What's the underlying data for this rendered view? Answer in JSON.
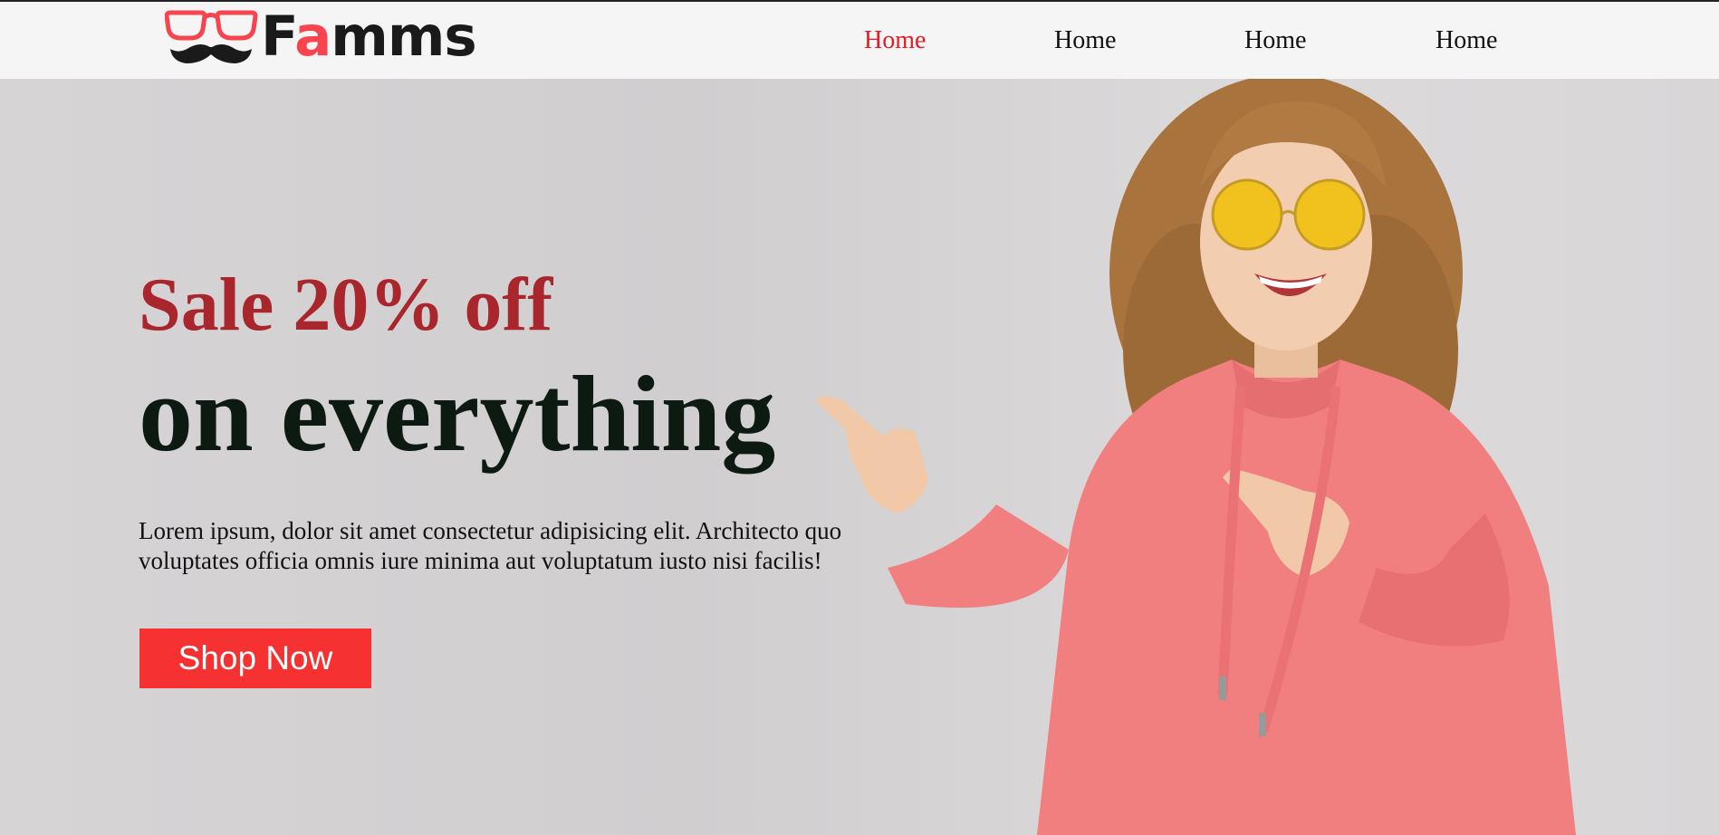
{
  "brand": {
    "prefix": "F",
    "accent": "a",
    "suffix": "mms",
    "accent_color": "#f7444e"
  },
  "nav": {
    "items": [
      {
        "label": "Home",
        "active": true
      },
      {
        "label": "Home",
        "active": false
      },
      {
        "label": "Home",
        "active": false
      },
      {
        "label": "Home",
        "active": false
      }
    ]
  },
  "hero": {
    "subtitle": "Sale 20% off",
    "title": "on everything",
    "description": "Lorem ipsum, dolor sit amet consectetur adipisicing elit. Architecto quo voluptates officia omnis iure minima aut voluptatum iusto nisi facilis!",
    "cta_label": "Shop Now",
    "cta_color": "#f53131",
    "image_alt": "woman in pink hoodie and yellow sunglasses pointing left"
  }
}
